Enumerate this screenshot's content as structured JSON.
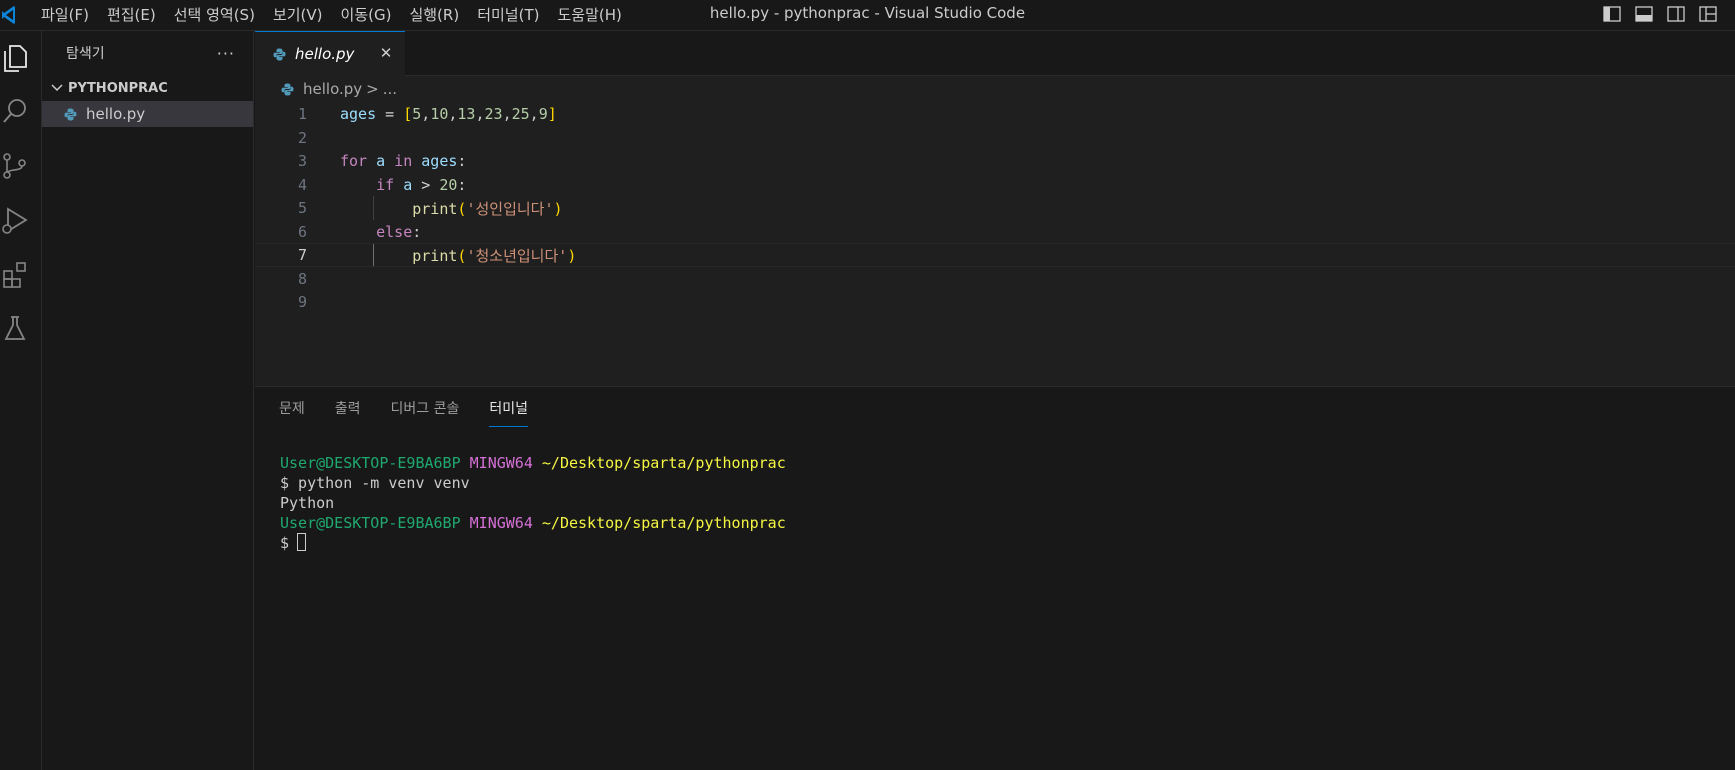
{
  "window": {
    "title": "hello.py - pythonprac - Visual Studio Code",
    "menu": [
      "파일(F)",
      "편집(E)",
      "선택 영역(S)",
      "보기(V)",
      "이동(G)",
      "실행(R)",
      "터미널(T)",
      "도움말(H)"
    ]
  },
  "colors": {
    "accent": "#0078d4",
    "background": "#181818",
    "editor_bg": "#1f1f1f"
  },
  "activity_bar": {
    "icons": [
      "explorer-icon",
      "search-icon",
      "source-control-icon",
      "run-debug-icon",
      "extensions-icon",
      "testing-icon"
    ]
  },
  "sidebar": {
    "title": "탐색기",
    "more": "···",
    "folder": "PYTHONPRAC",
    "files": [
      {
        "name": "hello.py",
        "icon": "python-file-icon"
      }
    ]
  },
  "editor": {
    "tab": {
      "label": "hello.py",
      "close": "✕"
    },
    "breadcrumb": {
      "file": "hello.py",
      "sep": ">",
      "rest": "..."
    },
    "current_line": 7,
    "lines": [
      {
        "n": "1",
        "text": "ages = [5,10,13,23,25,9]"
      },
      {
        "n": "2",
        "text": ""
      },
      {
        "n": "3",
        "text": "for a in ages:"
      },
      {
        "n": "4",
        "text": "    if a > 20:"
      },
      {
        "n": "5",
        "text": "        print('성인입니다')"
      },
      {
        "n": "6",
        "text": "    else:"
      },
      {
        "n": "7",
        "text": "        print('청소년입니다')"
      },
      {
        "n": "8",
        "text": ""
      },
      {
        "n": "9",
        "text": ""
      }
    ]
  },
  "panel": {
    "tabs": [
      "문제",
      "출력",
      "디버그 콘솔",
      "터미널"
    ],
    "active_tab": "터미널",
    "terminal": {
      "prompt_user": "User@DESKTOP-E9BA6BP",
      "prompt_env": "MINGW64",
      "prompt_path": "~/Desktop/sparta/pythonprac",
      "command": "$ python -m venv venv",
      "output": "Python",
      "prompt_symbol": "$"
    }
  }
}
